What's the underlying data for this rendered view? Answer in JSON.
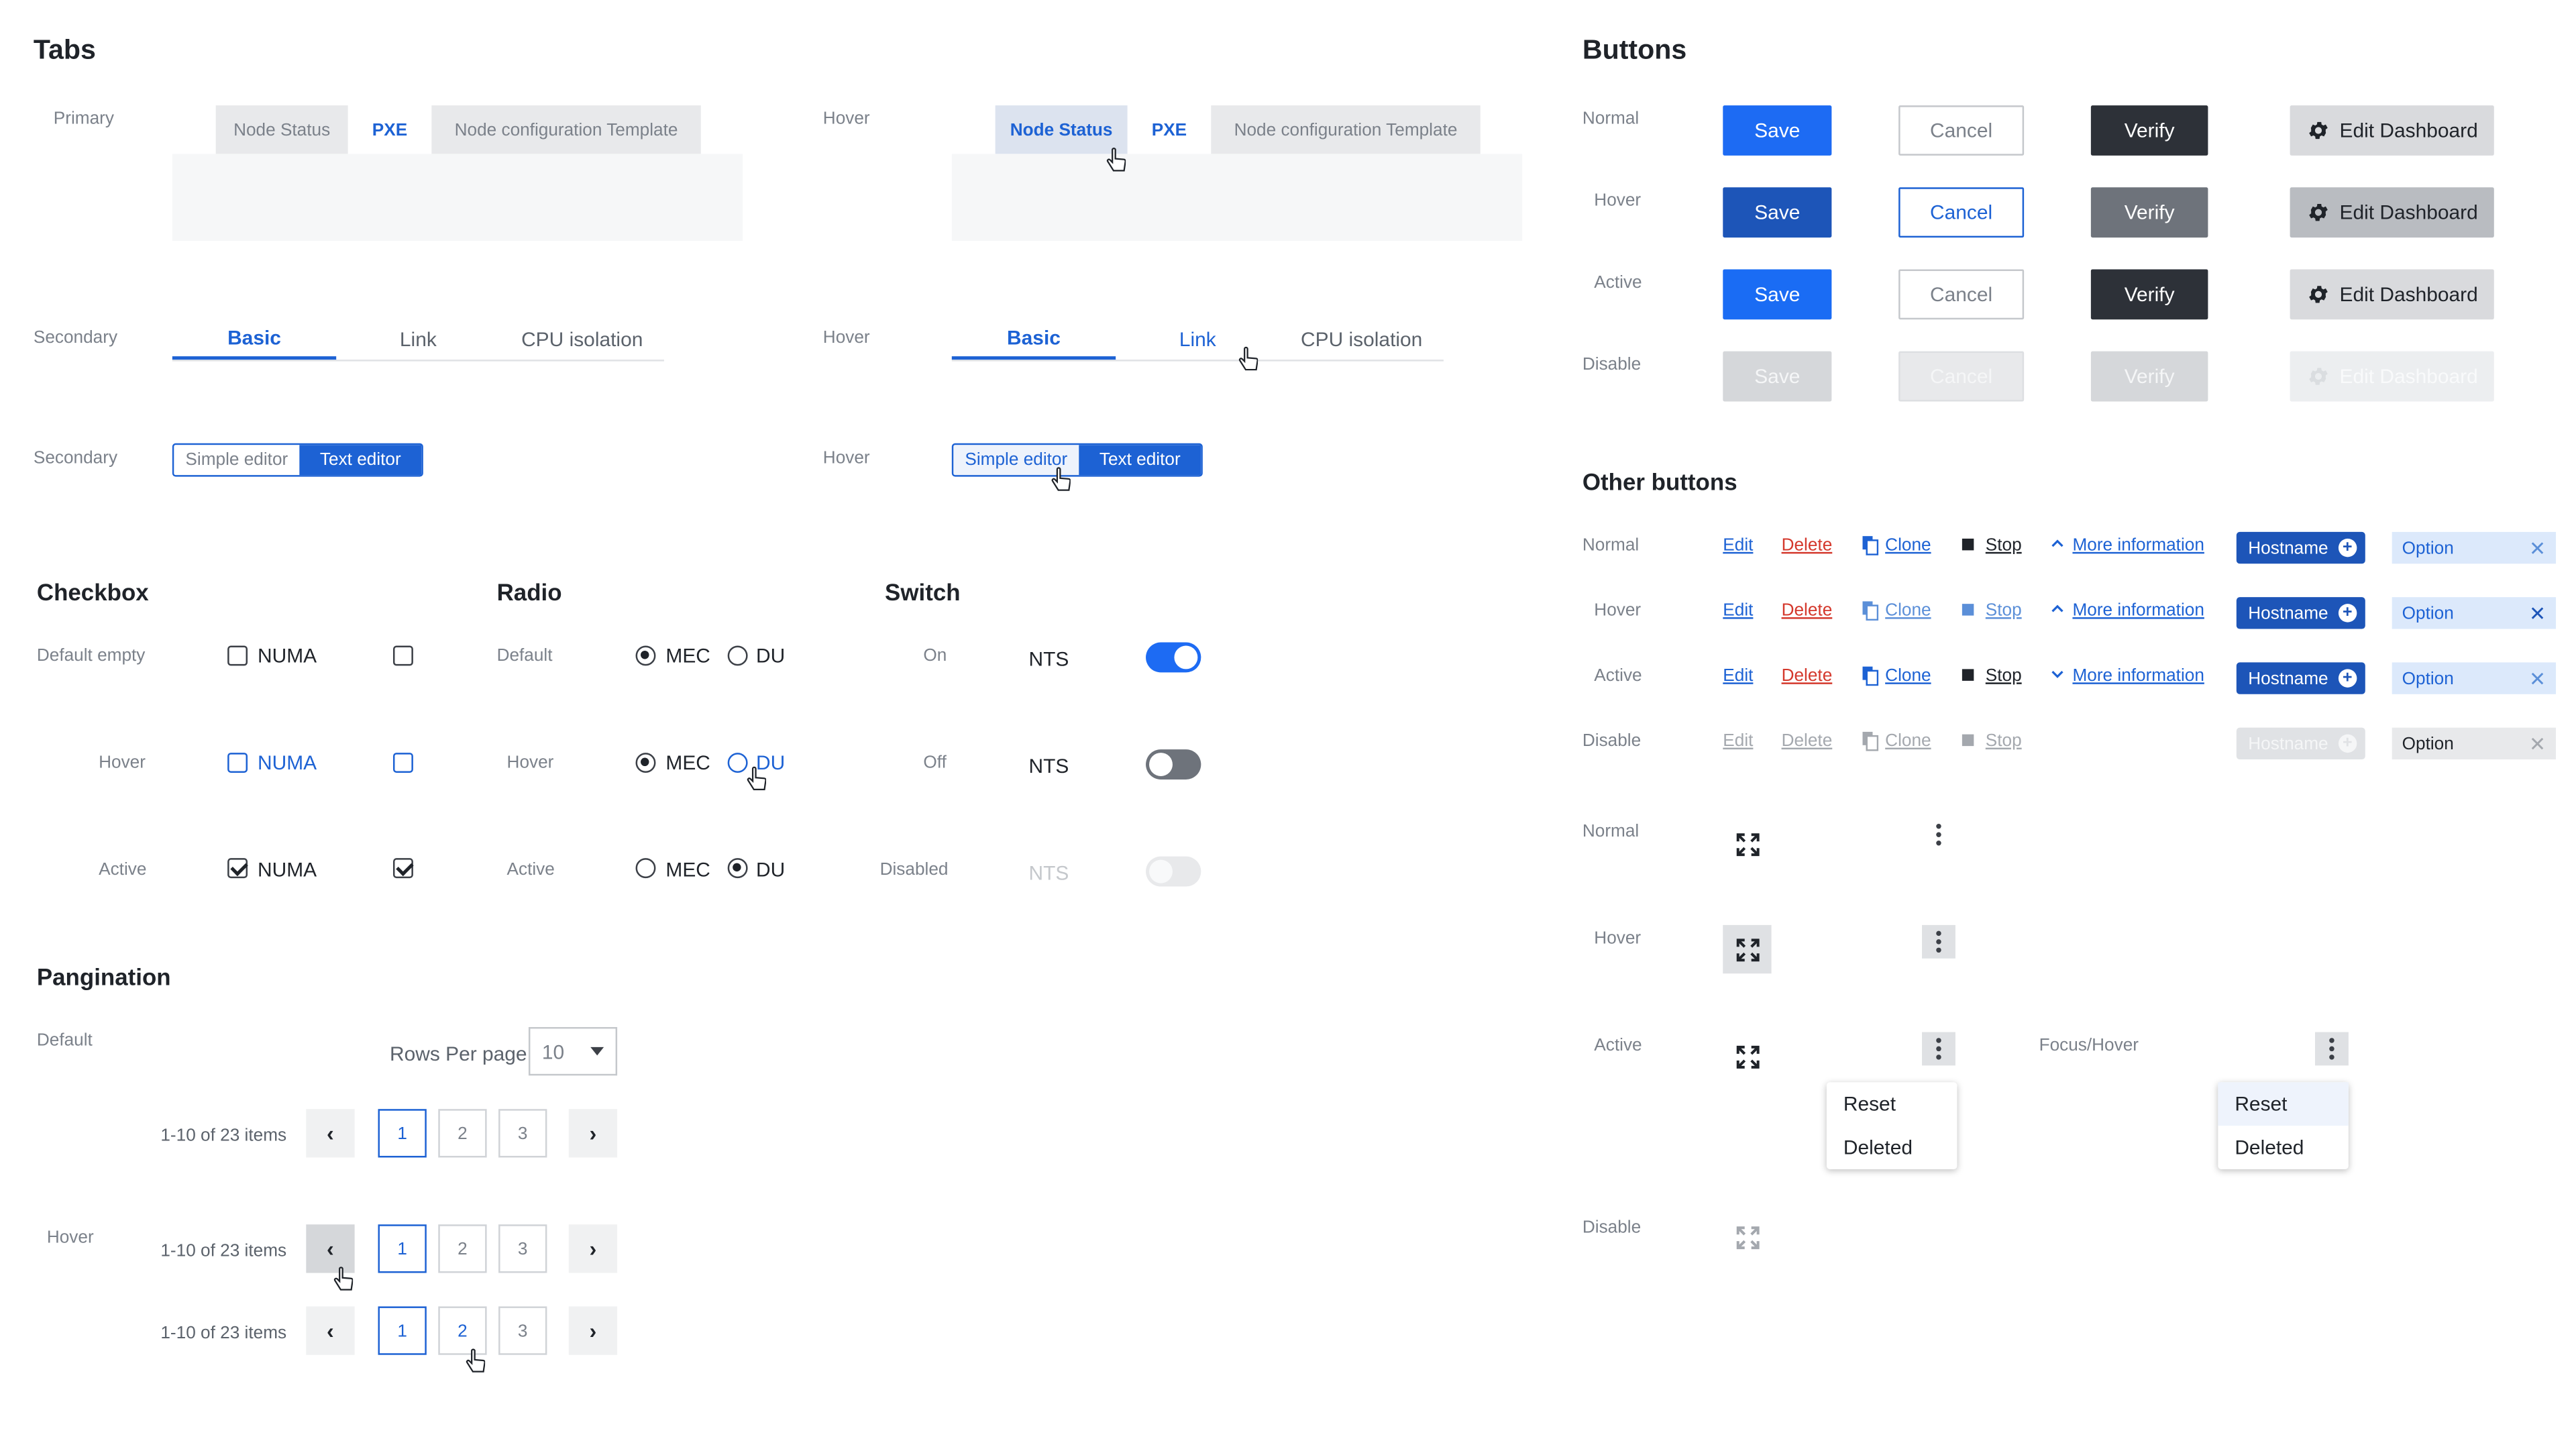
{
  "sections": {
    "tabs": "Tabs",
    "buttons": "Buttons",
    "other_buttons": "Other buttons",
    "checkbox": "Checkbox",
    "radio": "Radio",
    "switch": "Switch",
    "pagination": "Pangination"
  },
  "states": {
    "primary": "Primary",
    "secondary": "Secondary",
    "normal": "Normal",
    "hover": "Hover",
    "active": "Active",
    "disable": "Disable",
    "default": "Default",
    "default_empty": "Default empty",
    "on": "On",
    "off": "Off",
    "disabled": "Disabled",
    "focus_hover": "Focus/Hover"
  },
  "primary_tabs": [
    "Node Status",
    "PXE",
    "Node configuration Template"
  ],
  "secondary_tabs": [
    "Basic",
    "Link",
    "CPU isolation"
  ],
  "segmented": [
    "Simple editor",
    "Text editor"
  ],
  "buttons": {
    "save": "Save",
    "cancel": "Cancel",
    "verify": "Verify",
    "edit_dashboard": "Edit Dashboard"
  },
  "other": {
    "edit": "Edit",
    "delete": "Delete",
    "clone": "Clone",
    "stop": "Stop",
    "more_information": "More information",
    "hostname": "Hostname",
    "option": "Option"
  },
  "menu_items": [
    "Reset",
    "Deleted"
  ],
  "checkbox_label": "NUMA",
  "radio_labels": [
    "MEC",
    "DU"
  ],
  "switch_label": "NTS",
  "pagination": {
    "rows_per_page_label": "Rows Per page",
    "rows_per_page_value": "10",
    "summary": "1-10 of 23 items",
    "pages": [
      "1",
      "2",
      "3"
    ],
    "prev": "‹",
    "next": "›"
  },
  "colors": {
    "primary": "#1d6bf3",
    "danger": "#d4382c",
    "dark": "#2d3138"
  },
  "icons": [
    "gear-icon",
    "clone-icon",
    "stop-icon",
    "chevron-up-icon",
    "chevron-down-icon",
    "plus-circle-icon",
    "close-icon",
    "expand-icon",
    "kebab-icon",
    "hand-cursor-icon"
  ]
}
